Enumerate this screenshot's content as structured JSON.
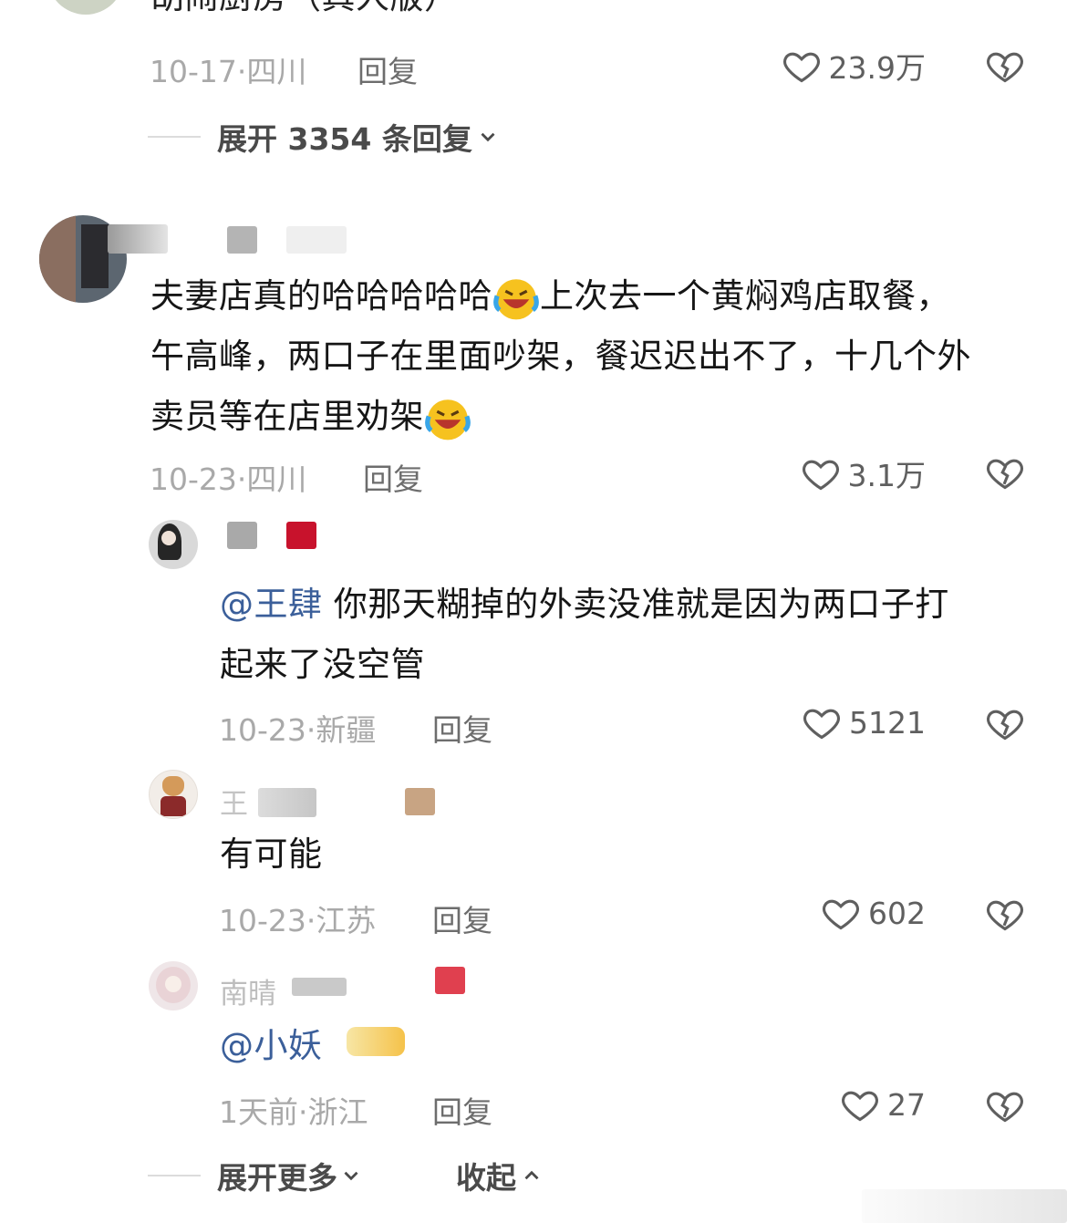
{
  "top_comment": {
    "text_partial": "胡闹厨房（真人版）",
    "date": "10-17",
    "location": "四川",
    "reply_label": "回复",
    "likes": "23.9万",
    "expand_label": "展开 3354 条回复"
  },
  "comment_main": {
    "text_line1": "夫妻店真的哈哈哈哈哈",
    "text_line1b": "上次去一个黄焖鸡店取餐，",
    "text_line2": "午高峰，两口子在里面吵架，餐迟迟出不了，十几个外",
    "text_line3": "卖员等在店里劝架",
    "date": "10-23",
    "location": "四川",
    "reply_label": "回复",
    "likes": "3.1万"
  },
  "replies": [
    {
      "mention": "@王肆",
      "text_a": " 你那天糊掉的外卖没准就是因为两口子打",
      "text_b": "起来了没空管",
      "date": "10-23",
      "location": "新疆",
      "reply_label": "回复",
      "likes": "5121"
    },
    {
      "name_partial": "王",
      "text": "有可能",
      "date": "10-23",
      "location": "江苏",
      "reply_label": "回复",
      "likes": "602"
    },
    {
      "name_partial": "南晴",
      "mention": "@小妖",
      "date": "1天前",
      "location": "浙江",
      "reply_label": "回复",
      "likes": "27"
    }
  ],
  "footer": {
    "expand_more": "展开更多",
    "collapse": "收起"
  },
  "colors": {
    "mention": "#3b5f9a",
    "meta": "#a9a9a9",
    "text": "#161616"
  }
}
